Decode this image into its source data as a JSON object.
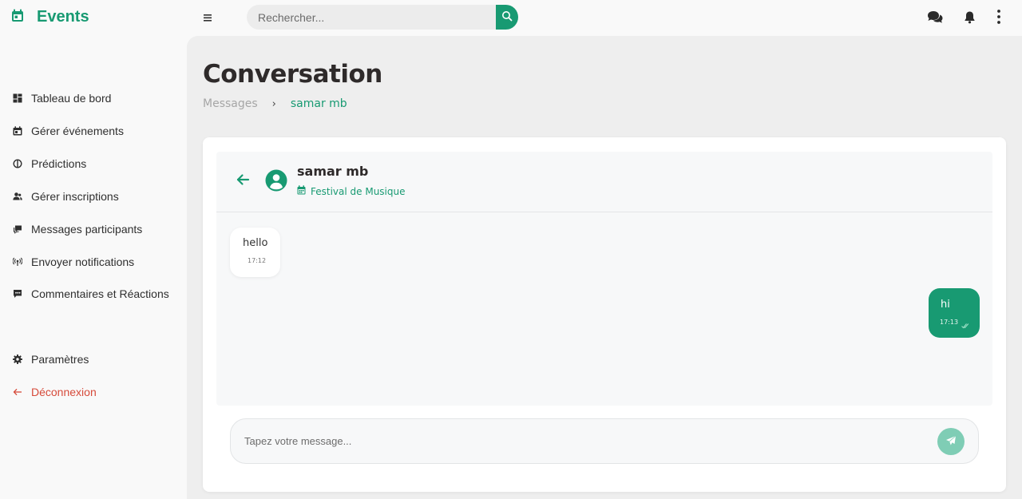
{
  "app": {
    "title": "Events"
  },
  "search": {
    "placeholder": "Rechercher..."
  },
  "sidebar": {
    "items": [
      {
        "label": "Tableau de bord",
        "icon": "dashboard-icon"
      },
      {
        "label": "Gérer événements",
        "icon": "calendar-icon"
      },
      {
        "label": "Prédictions",
        "icon": "predictions-icon"
      },
      {
        "label": "Gérer inscriptions",
        "icon": "users-icon"
      },
      {
        "label": "Messages participants",
        "icon": "chat-icon"
      },
      {
        "label": "Envoyer notifications",
        "icon": "broadcast-icon"
      },
      {
        "label": "Commentaires et Réactions",
        "icon": "comment-icon"
      }
    ],
    "settings": {
      "label": "Paramètres",
      "icon": "gear-icon"
    },
    "logout": {
      "label": "Déconnexion",
      "icon": "arrow-left-icon"
    }
  },
  "page": {
    "title": "Conversation",
    "breadcrumb": {
      "parent": "Messages",
      "separator": "›",
      "current": "samar mb"
    }
  },
  "conversation": {
    "contact_name": "samar mb",
    "event": "Festival de Musique",
    "messages": [
      {
        "direction": "incoming",
        "text": "hello",
        "time": "17:12"
      },
      {
        "direction": "outgoing",
        "text": "hi",
        "time": "17:13",
        "status": "read"
      }
    ],
    "composer_placeholder": "Tapez votre message..."
  },
  "colors": {
    "accent": "#189a72",
    "send_button": "#7fcdb5",
    "logout": "#d64a3a",
    "main_bg": "#eeeeee"
  }
}
